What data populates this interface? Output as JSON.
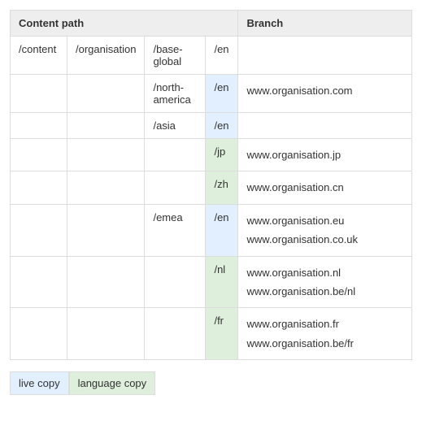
{
  "headers": {
    "content_path": "Content path",
    "branch": "Branch"
  },
  "rows": [
    {
      "a": "/content",
      "b": "/organisation",
      "c": "/base-global",
      "d": "/en",
      "d_class": "",
      "branch": []
    },
    {
      "a": "",
      "b": "",
      "c": "/north-america",
      "d": "/en",
      "d_class": "live",
      "branch": [
        "www.organisation.com"
      ]
    },
    {
      "a": "",
      "b": "",
      "c": "/asia",
      "d": "/en",
      "d_class": "live",
      "branch": []
    },
    {
      "a": "",
      "b": "",
      "c": "",
      "d": "/jp",
      "d_class": "lang",
      "branch": [
        "www.organisation.jp"
      ]
    },
    {
      "a": "",
      "b": "",
      "c": "",
      "d": "/zh",
      "d_class": "lang",
      "branch": [
        "www.organisation.cn"
      ]
    },
    {
      "a": "",
      "b": "",
      "c": "/emea",
      "d": "/en",
      "d_class": "live",
      "branch": [
        "www.organisation.eu",
        "www.organisation.co.uk"
      ]
    },
    {
      "a": "",
      "b": "",
      "c": "",
      "d": "/nl",
      "d_class": "lang",
      "branch": [
        "www.organisation.nl",
        "www.organisation.be/nl"
      ]
    },
    {
      "a": "",
      "b": "",
      "c": "",
      "d": "/fr",
      "d_class": "lang",
      "branch": [
        "www.organisation.fr",
        "www.organisation.be/fr"
      ]
    }
  ],
  "legend": {
    "live": "live copy",
    "lang": "language copy"
  }
}
